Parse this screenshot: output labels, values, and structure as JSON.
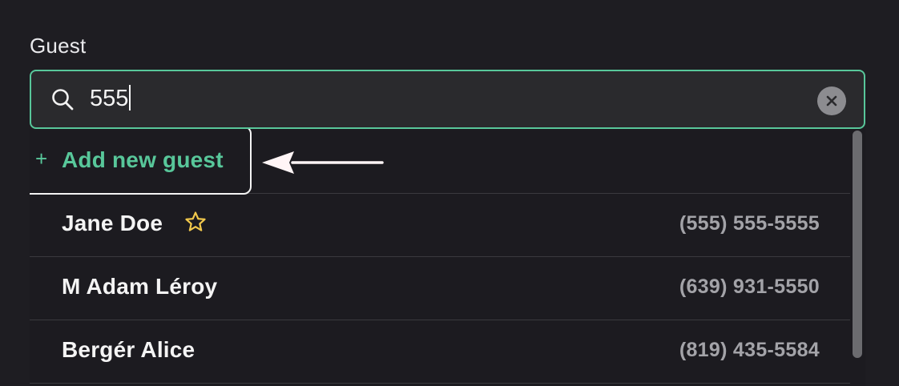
{
  "field": {
    "label": "Guest"
  },
  "search": {
    "value": "555",
    "icon": "search-icon",
    "clear_icon": "close-icon"
  },
  "dropdown": {
    "add_option": {
      "icon": "+",
      "label": "Add new guest"
    },
    "guests": [
      {
        "name": "Jane Doe",
        "phone": "(555) 555-5555",
        "favorite": true
      },
      {
        "name": "M Adam Léroy",
        "phone": "(639) 931-5550",
        "favorite": false
      },
      {
        "name": "Bergér Alice",
        "phone": "(819) 435-5584",
        "favorite": false
      }
    ]
  },
  "colors": {
    "accent": "#58c79a",
    "background": "#1e1d22",
    "star": "#f2c94c"
  }
}
